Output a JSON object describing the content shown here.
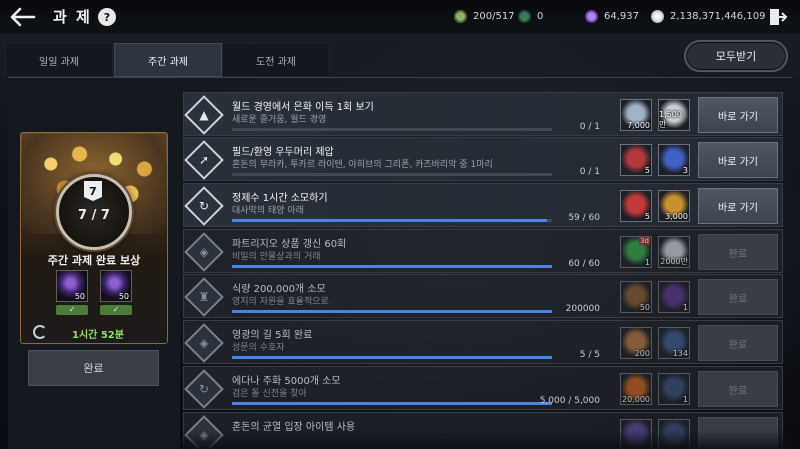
{
  "header": {
    "title": "과 제",
    "help_label": "?",
    "currencies": [
      {
        "icon": "stamina-icon",
        "value": "200/517"
      },
      {
        "icon": "gem-icon",
        "value": "0"
      },
      {
        "icon": "purple-crystal-icon",
        "value": "64,937"
      },
      {
        "icon": "silver-coin-icon",
        "value": "2,138,371,446,109"
      }
    ]
  },
  "tabs": [
    {
      "label": "일일 과제",
      "active": false
    },
    {
      "label": "주간 과제",
      "active": true
    },
    {
      "label": "도전 과제",
      "active": false
    }
  ],
  "receive_all_label": "모두받기",
  "reward_panel": {
    "badge": "7",
    "count": "7 / 7",
    "title": "주간 과제 완료 보상",
    "rewards": [
      {
        "amount": "50"
      },
      {
        "amount": "50"
      }
    ],
    "check": "✓",
    "timer": "1시간 52분",
    "button_label": "완료"
  },
  "quests": [
    {
      "title": "월드 경영에서 은화 이득 1회 보기",
      "subtitle": "새로운 즐거움, 월드 경영",
      "progress_text": "0 / 1",
      "progress": 0.0,
      "rewards": [
        {
          "kind": "tickets",
          "amount": "7,000",
          "color": "#9fb3c8"
        },
        {
          "kind": "silver",
          "amount": "1,500만",
          "color": "#c9ccd2"
        }
      ],
      "button": "바로 가기",
      "enabled": true,
      "glyph": "▲"
    },
    {
      "title": "필드/환영 우두머리 제압",
      "subtitle": "혼돈의 무라카, 투카르 라이텐, 아히브의 그리폰, 카즈바리악 중 1마리",
      "progress_text": "0 / 1",
      "progress": 0.0,
      "rewards": [
        {
          "kind": "orange-box",
          "amount": "5",
          "color": "#b2393f"
        },
        {
          "kind": "blue-box",
          "amount": "3",
          "color": "#4161c6"
        }
      ],
      "button": "바로 가기",
      "enabled": true,
      "glyph": "➚"
    },
    {
      "title": "정제수 1시간 소모하기",
      "subtitle": "대사막의 태양 아래",
      "progress_text": "59 / 60",
      "progress": 0.983,
      "rewards": [
        {
          "kind": "ticket",
          "amount": "5",
          "color": "#c33a3a"
        },
        {
          "kind": "gold",
          "amount": "3,000",
          "color": "#c9902e"
        }
      ],
      "button": "바로 가기",
      "enabled": true,
      "glyph": "↻"
    },
    {
      "title": "파트리지오 상품 갱신 60회",
      "subtitle": "비밀의 만물상과의 거래",
      "progress_text": "60 / 60",
      "progress": 1.0,
      "rewards": [
        {
          "kind": "green-ticket",
          "amount": "1",
          "tag": "3d",
          "color": "#3aa24a"
        },
        {
          "kind": "silver",
          "amount": "2000만",
          "color": "#c9ccd2"
        }
      ],
      "button": "완료",
      "enabled": false,
      "glyph": "◈"
    },
    {
      "title": "식량 200,000개 소모",
      "subtitle": "영지의 자원을 효율적으로",
      "progress_text": "200000",
      "progress": 1.0,
      "rewards": [
        {
          "kind": "chest",
          "amount": "50",
          "color": "#8a5a32"
        },
        {
          "kind": "gift",
          "amount": "1",
          "color": "#5c3a8a"
        }
      ],
      "button": "완료",
      "enabled": false,
      "glyph": "♜"
    },
    {
      "title": "영광의 길 5회 완료",
      "subtitle": "성문의 수호자",
      "progress_text": "5 / 5",
      "progress": 1.0,
      "rewards": [
        {
          "kind": "bronze",
          "amount": "200",
          "color": "#b0763f"
        },
        {
          "kind": "medal",
          "amount": "134",
          "color": "#3d5d8a"
        }
      ],
      "button": "완료",
      "enabled": false,
      "glyph": "◈"
    },
    {
      "title": "에다나 주화 5000개 소모",
      "subtitle": "검은 돌 신전을 찾아",
      "progress_text": "5,000 / 5,000",
      "progress": 1.0,
      "rewards": [
        {
          "kind": "fire",
          "amount": "20,000",
          "color": "#c5621f"
        },
        {
          "kind": "scroll",
          "amount": "1",
          "color": "#3a4f78"
        }
      ],
      "button": "완료",
      "enabled": false,
      "glyph": "↻"
    },
    {
      "title": "혼돈의 균열 입장 아이템 사용",
      "subtitle": "",
      "progress_text": "",
      "progress": 0.0,
      "rewards": [
        {
          "kind": "gem",
          "amount": "",
          "color": "#5a4a9a"
        },
        {
          "kind": "box",
          "amount": "",
          "color": "#3a4f78"
        }
      ],
      "button": "",
      "enabled": false,
      "glyph": "◈"
    }
  ]
}
